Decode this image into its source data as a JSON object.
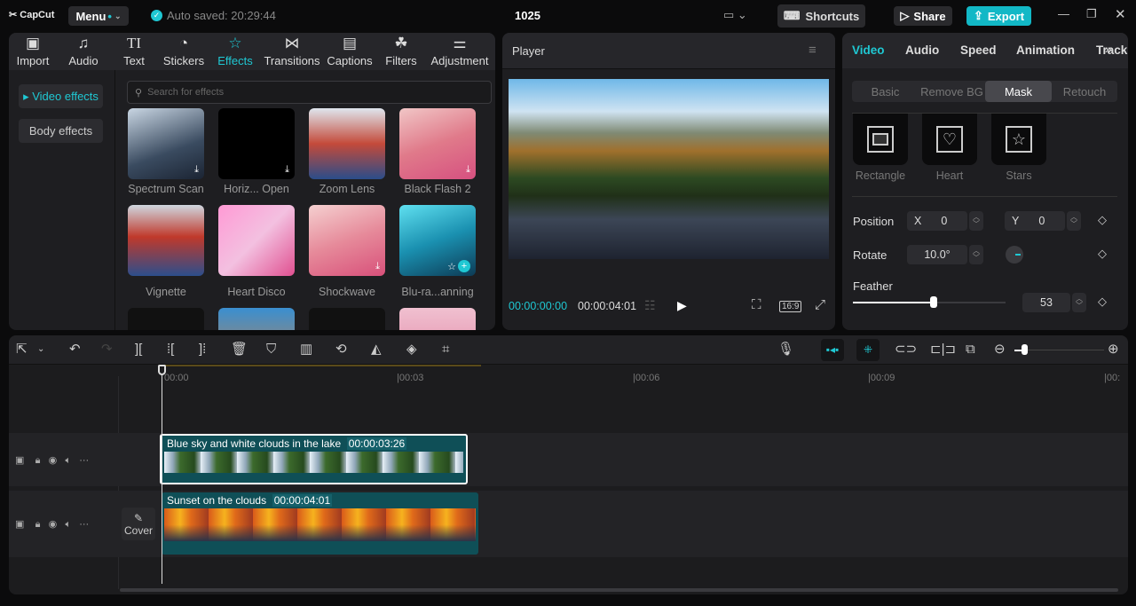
{
  "app": {
    "logo": "CapCut",
    "menu": "Menu",
    "autosave": "Auto saved: 20:29:44",
    "project": "1025",
    "shortcuts": "Shortcuts",
    "share": "Share",
    "export": "Export"
  },
  "colors": {
    "accent": "#1fc8d3",
    "export": "#12b8c6",
    "clip": "#0f4f57"
  },
  "media_tabs": [
    {
      "label": "Import",
      "icon": "import-icon"
    },
    {
      "label": "Audio",
      "icon": "audio-icon"
    },
    {
      "label": "Text",
      "icon": "text-icon"
    },
    {
      "label": "Stickers",
      "icon": "stickers-icon"
    },
    {
      "label": "Effects",
      "icon": "effects-icon"
    },
    {
      "label": "Transitions",
      "icon": "transitions-icon"
    },
    {
      "label": "Captions",
      "icon": "captions-icon"
    },
    {
      "label": "Filters",
      "icon": "filters-icon"
    },
    {
      "label": "Adjustment",
      "icon": "adjustment-icon"
    }
  ],
  "effects_sidebar": {
    "video": "Video effects",
    "body": "Body effects"
  },
  "search": {
    "placeholder": "Search for effects"
  },
  "effects": [
    {
      "label": "Spectrum Scan"
    },
    {
      "label": "Horiz... Open"
    },
    {
      "label": "Zoom Lens"
    },
    {
      "label": "Black Flash 2"
    },
    {
      "label": "Vignette"
    },
    {
      "label": "Heart Disco"
    },
    {
      "label": "Shockwave"
    },
    {
      "label": "Blu-ra...anning"
    }
  ],
  "player": {
    "title": "Player",
    "current": "00:00:00:00",
    "total": "00:00:04:01",
    "ratio": "16:9"
  },
  "inspector": {
    "tabs": [
      "Video",
      "Audio",
      "Speed",
      "Animation",
      "Tracki"
    ],
    "subtabs": [
      "Basic",
      "Remove BG",
      "Mask",
      "Retouch"
    ],
    "masks": [
      "Rectangle",
      "Heart",
      "Stars"
    ],
    "position_label": "Position",
    "x_label": "X",
    "x": "0",
    "y_label": "Y",
    "y": "0",
    "rotate_label": "Rotate",
    "rotate": "10.0°",
    "feather_label": "Feather",
    "feather": "53",
    "feather_fraction": 0.53
  },
  "timeline": {
    "ticks": [
      "00:00",
      "00:03",
      "00:06",
      "00:09",
      "00:"
    ],
    "cover": "Cover",
    "clips": [
      {
        "name": "Blue sky and white clouds in the lake",
        "duration": "00:00:03:26"
      },
      {
        "name": "Sunset on the clouds",
        "duration": "00:00:04:01"
      }
    ]
  }
}
